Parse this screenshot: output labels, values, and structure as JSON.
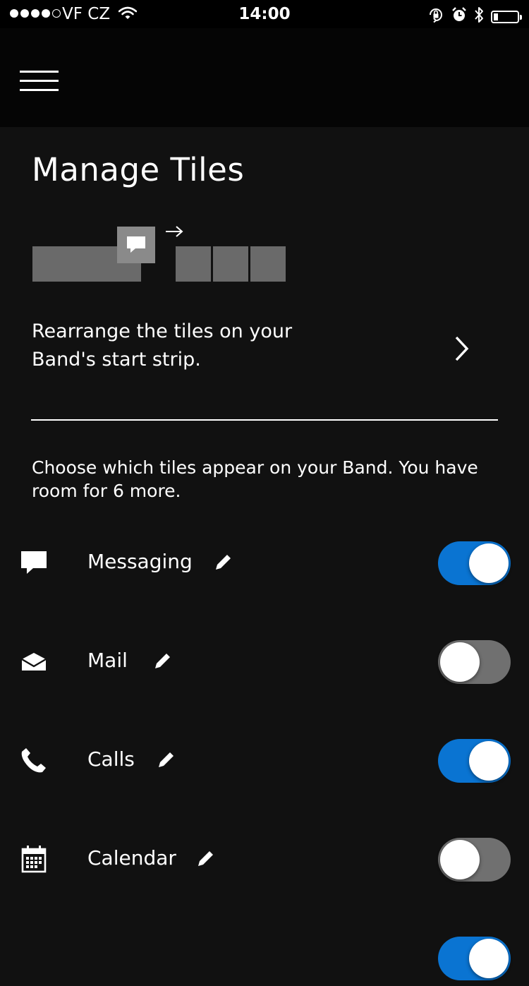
{
  "status_bar": {
    "signal_dots": [
      "filled",
      "filled",
      "filled",
      "filled",
      "empty"
    ],
    "carrier": "VF CZ",
    "time": "14:00",
    "battery_level": 0.15
  },
  "header": {
    "menu_icon": "hamburger-icon"
  },
  "page": {
    "title": "Manage Tiles"
  },
  "rearrange": {
    "text": "Rearrange the tiles on your Band's start strip.",
    "chevron_icon": "chevron-right-icon"
  },
  "choose": {
    "text": "Choose which tiles appear on your Band. You have room for 6 more."
  },
  "tiles": [
    {
      "label": "Messaging",
      "icon": "message-icon",
      "enabled": true
    },
    {
      "label": "Mail",
      "icon": "mail-icon",
      "enabled": false
    },
    {
      "label": "Calls",
      "icon": "phone-icon",
      "enabled": true
    },
    {
      "label": "Calendar",
      "icon": "calendar-icon",
      "enabled": false
    },
    {
      "label": "",
      "icon": "",
      "enabled": true
    }
  ],
  "colors": {
    "accent": "#0a74d2",
    "background": "#111111",
    "toggle_off": "#707070"
  }
}
